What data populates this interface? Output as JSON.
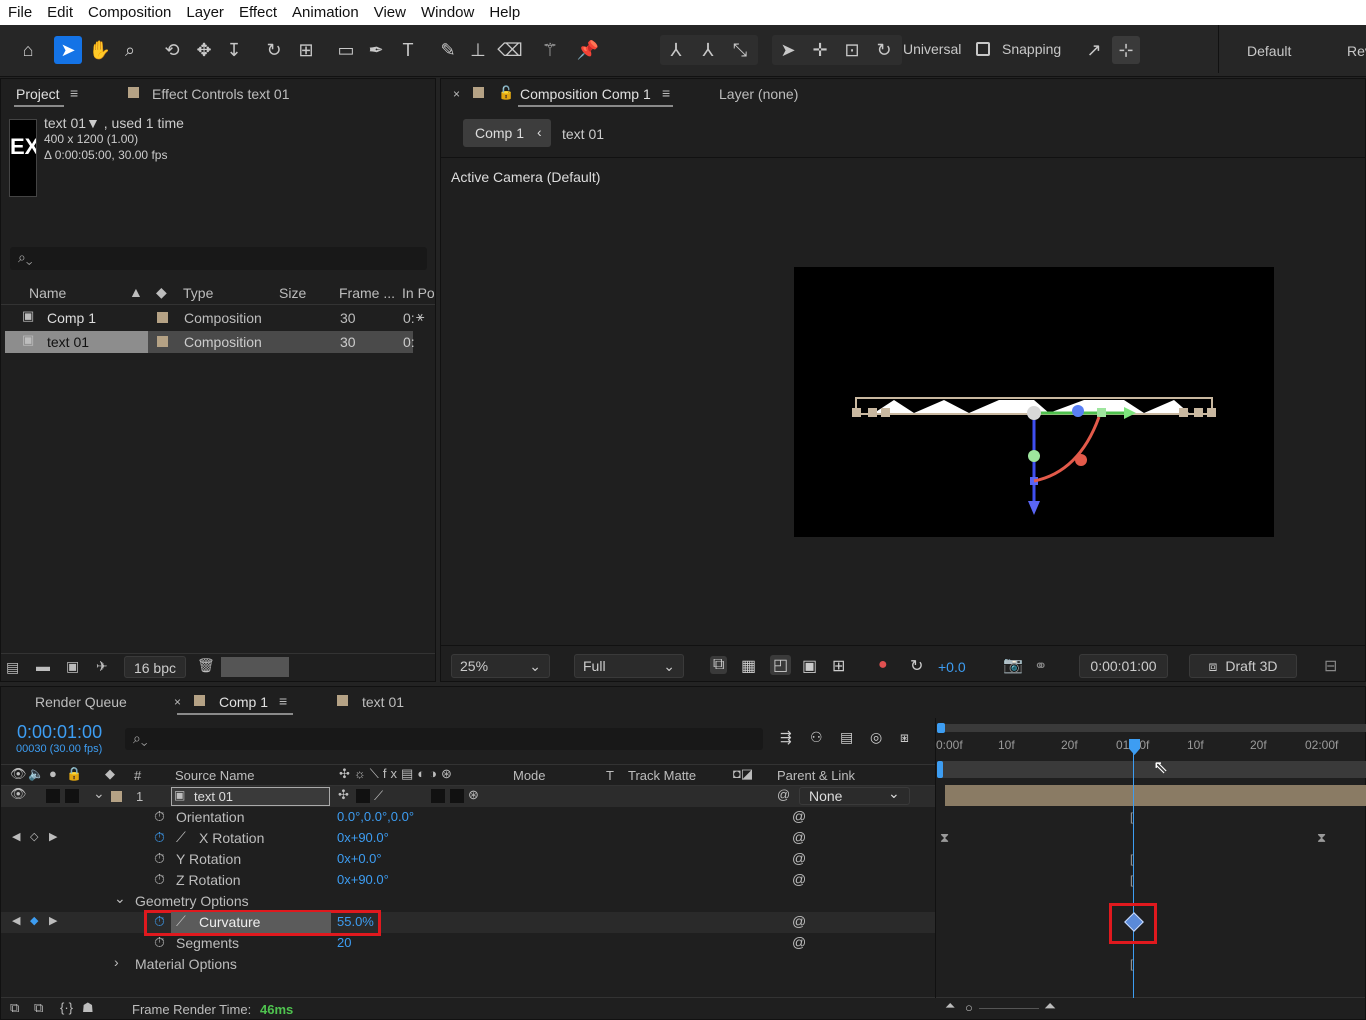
{
  "menu": [
    "File",
    "Edit",
    "Composition",
    "Layer",
    "Effect",
    "Animation",
    "View",
    "Window",
    "Help"
  ],
  "toolbar": {
    "universal": "Universal",
    "snapping": "Snapping",
    "workspace": "Default",
    "workspace2": "Rev"
  },
  "project": {
    "tab_project": "Project",
    "tab_effect": "Effect Controls text 01",
    "thumb_text": "EX",
    "info_name": "text 01▼ , used 1 time",
    "info_dims": "400 x 1200 (1.00)",
    "info_dur": "Δ 0:00:05:00, 30.00 fps",
    "search_placeholder": "",
    "columns": [
      "Name",
      "Type",
      "Size",
      "Frame ...",
      "In Po"
    ],
    "items": [
      {
        "name": "Comp 1",
        "type": "Composition",
        "frame": "30",
        "inpo": "0:"
      },
      {
        "name": "text 01",
        "type": "Composition",
        "frame": "30",
        "inpo": "0:"
      }
    ],
    "bpc": "16 bpc"
  },
  "viewer": {
    "tab_comp": "Composition Comp 1",
    "tab_layer": "Layer (none)",
    "crumb1": "Comp 1",
    "crumb2": "text 01",
    "camera": "Active Camera (Default)",
    "zoom": "25%",
    "resolution": "Full",
    "exposure": "+0.0",
    "timecode": "0:00:01:00",
    "renderer": "Draft 3D"
  },
  "timeline": {
    "tab_render": "Render Queue",
    "tab_comp": "Comp 1",
    "tab_text": "text 01",
    "time": "0:00:01:00",
    "frames": "00030 (30.00 fps)",
    "col_hash": "#",
    "col_source": "Source Name",
    "col_mode": "Mode",
    "col_t": "T",
    "col_matte": "Track Matte",
    "col_parent": "Parent & Link",
    "layer_num": "1",
    "layer_name": "text 01",
    "parent": "None",
    "props": [
      {
        "name": "Orientation",
        "value": "0.0°,0.0°,0.0°"
      },
      {
        "name": "X Rotation",
        "value": "0x+90.0°"
      },
      {
        "name": "Y Rotation",
        "value": "0x+0.0°"
      },
      {
        "name": "Z Rotation",
        "value": "0x+90.0°"
      },
      {
        "name": "Geometry Options",
        "value": ""
      },
      {
        "name": "Curvature",
        "value": "55.0%"
      },
      {
        "name": "Segments",
        "value": "20"
      },
      {
        "name": "Material Options",
        "value": ""
      }
    ],
    "ruler": [
      "0:00f",
      "10f",
      "20f",
      "01:00f",
      "10f",
      "20f",
      "02:00f"
    ],
    "render_time_label": "Frame Render Time:",
    "render_time_value": "46ms"
  },
  "colors": {
    "accent": "#1473e6",
    "value_blue": "#3d9df2",
    "highlight_red": "#e0191e",
    "swatch": "#b5a285",
    "render_green": "#4fc34f"
  }
}
